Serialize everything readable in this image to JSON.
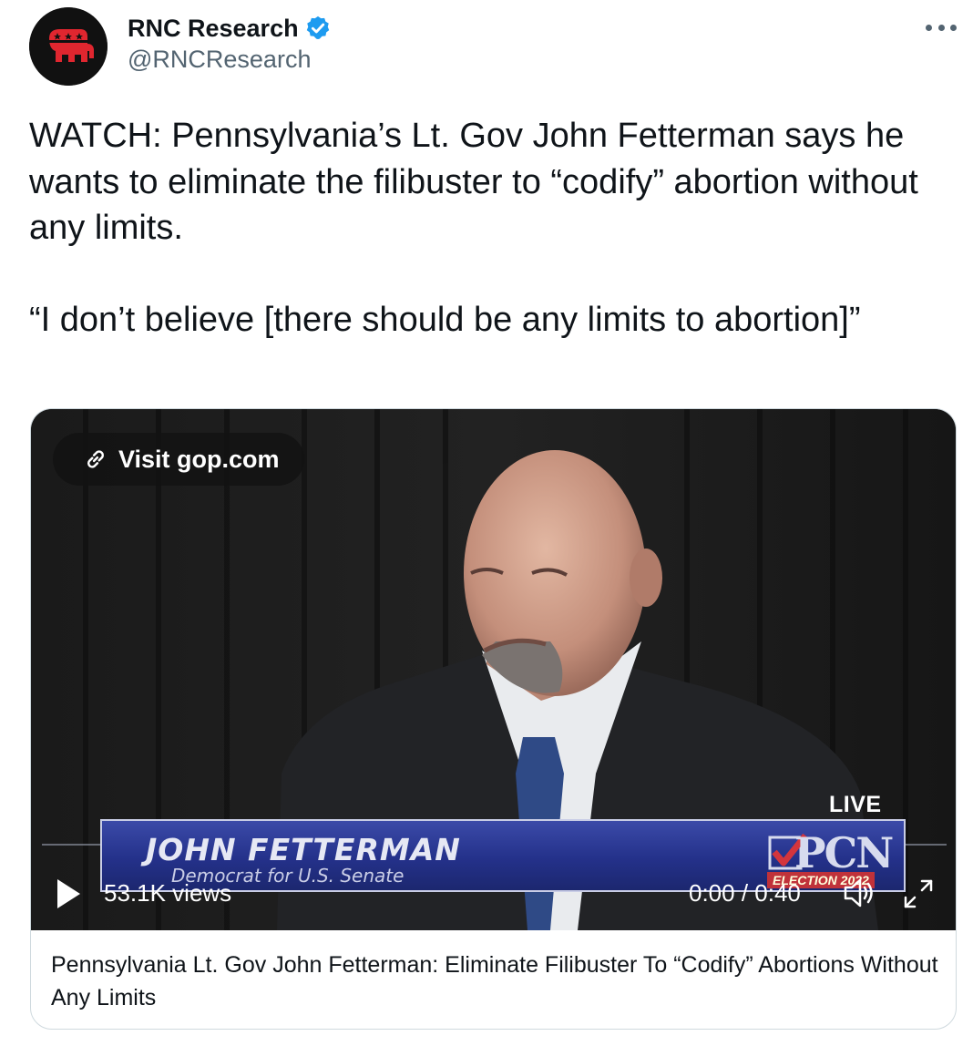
{
  "author": {
    "name": "RNC Research",
    "handle": "@RNCResearch",
    "avatar_icon": "republican-elephant-icon",
    "verified_icon": "verified-badge-icon",
    "verified_color": "#1d9bf0"
  },
  "more_icon": "more-options-icon",
  "tweet": {
    "paragraph_1": "WATCH: Pennsylvania’s Lt. Gov John Fetterman says he wants to eliminate the filibuster to “codify” abortion without any limits.",
    "paragraph_2": "“I don’t believe [there should be any limits to abortion]”"
  },
  "media": {
    "visit_label": "Visit gop.com",
    "visit_icon": "link-icon",
    "live_label": "LIVE",
    "banner_name": "JOHN FETTERMAN",
    "banner_subtitle": "Democrat for U.S. Senate",
    "network_logo": "PCN",
    "network_tag": "ELECTION 2022",
    "views": "53.1K views",
    "time": "0:00 / 0:40",
    "play_icon": "play-icon",
    "volume_icon": "volume-icon",
    "fullscreen_icon": "fullscreen-icon"
  },
  "card": {
    "title": "Pennsylvania Lt. Gov John Fetterman: Eliminate Filibuster To “Codify” Abortions Without Any Limits"
  },
  "colors": {
    "text": "#0f1419",
    "secondary_text": "#536471",
    "border": "#cfd9de",
    "brand_red": "#e0262f"
  }
}
